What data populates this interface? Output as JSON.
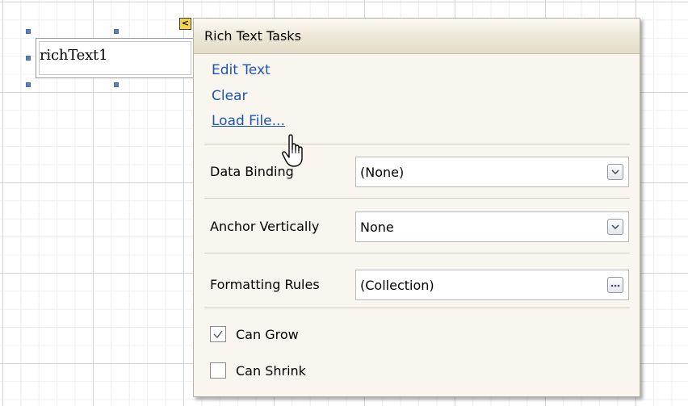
{
  "control": {
    "text": "richText1"
  },
  "panel": {
    "title": "Rich Text Tasks",
    "smart_tag_glyph": "<",
    "links": [
      {
        "label": "Edit Text"
      },
      {
        "label": "Clear"
      },
      {
        "label": "Load File..."
      }
    ],
    "properties": [
      {
        "label": "Data Binding",
        "value": "(None)",
        "button": "chevron-down-icon"
      },
      {
        "label": "Anchor Vertically",
        "value": "None",
        "button": "chevron-down-icon"
      },
      {
        "label": "Formatting Rules",
        "value": "(Collection)",
        "button": "ellipsis-icon"
      }
    ],
    "checkboxes": [
      {
        "label": "Can Grow",
        "checked": true
      },
      {
        "label": "Can Shrink",
        "checked": false
      }
    ]
  },
  "colors": {
    "link": "#1d55b8",
    "selection_handle": "#5d7fb8",
    "smart_tag": "#f4d54a"
  }
}
